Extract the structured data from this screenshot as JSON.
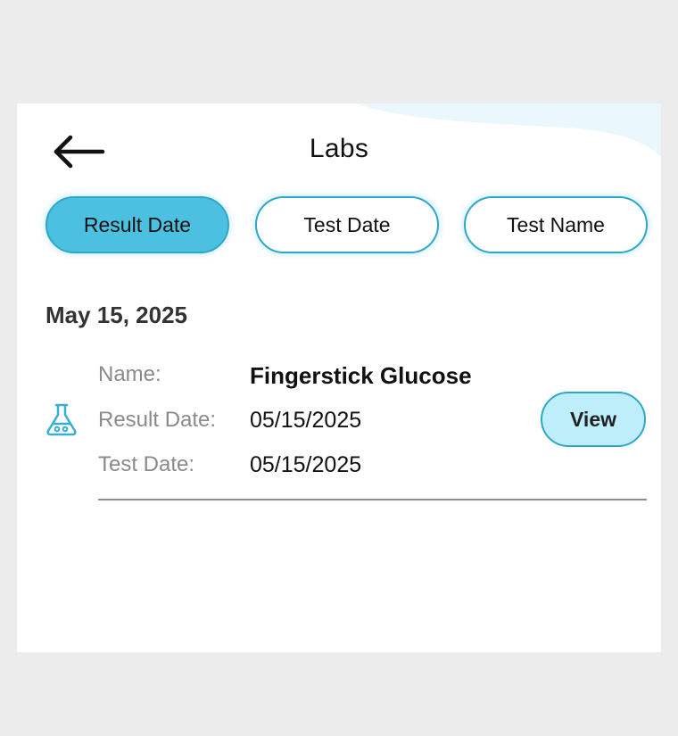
{
  "header": {
    "title": "Labs",
    "back_icon": "arrow-left-icon"
  },
  "filters": [
    {
      "label": "Result Date",
      "active": true
    },
    {
      "label": "Test Date",
      "active": false
    },
    {
      "label": "Test Name",
      "active": false
    }
  ],
  "groups": [
    {
      "date": "May 15, 2025",
      "items": [
        {
          "icon": "flask-icon",
          "name_label": "Name:",
          "name": "Fingerstick Glucose",
          "result_date_label": "Result Date:",
          "result_date": "05/15/2025",
          "test_date_label": "Test Date:",
          "test_date": "05/15/2025",
          "action_label": "View"
        }
      ]
    }
  ],
  "colors": {
    "accent": "#4cc0e1",
    "accent_border": "#2fa7c9",
    "view_button_bg": "#bdeef9",
    "wave": "#eaf7fc"
  }
}
